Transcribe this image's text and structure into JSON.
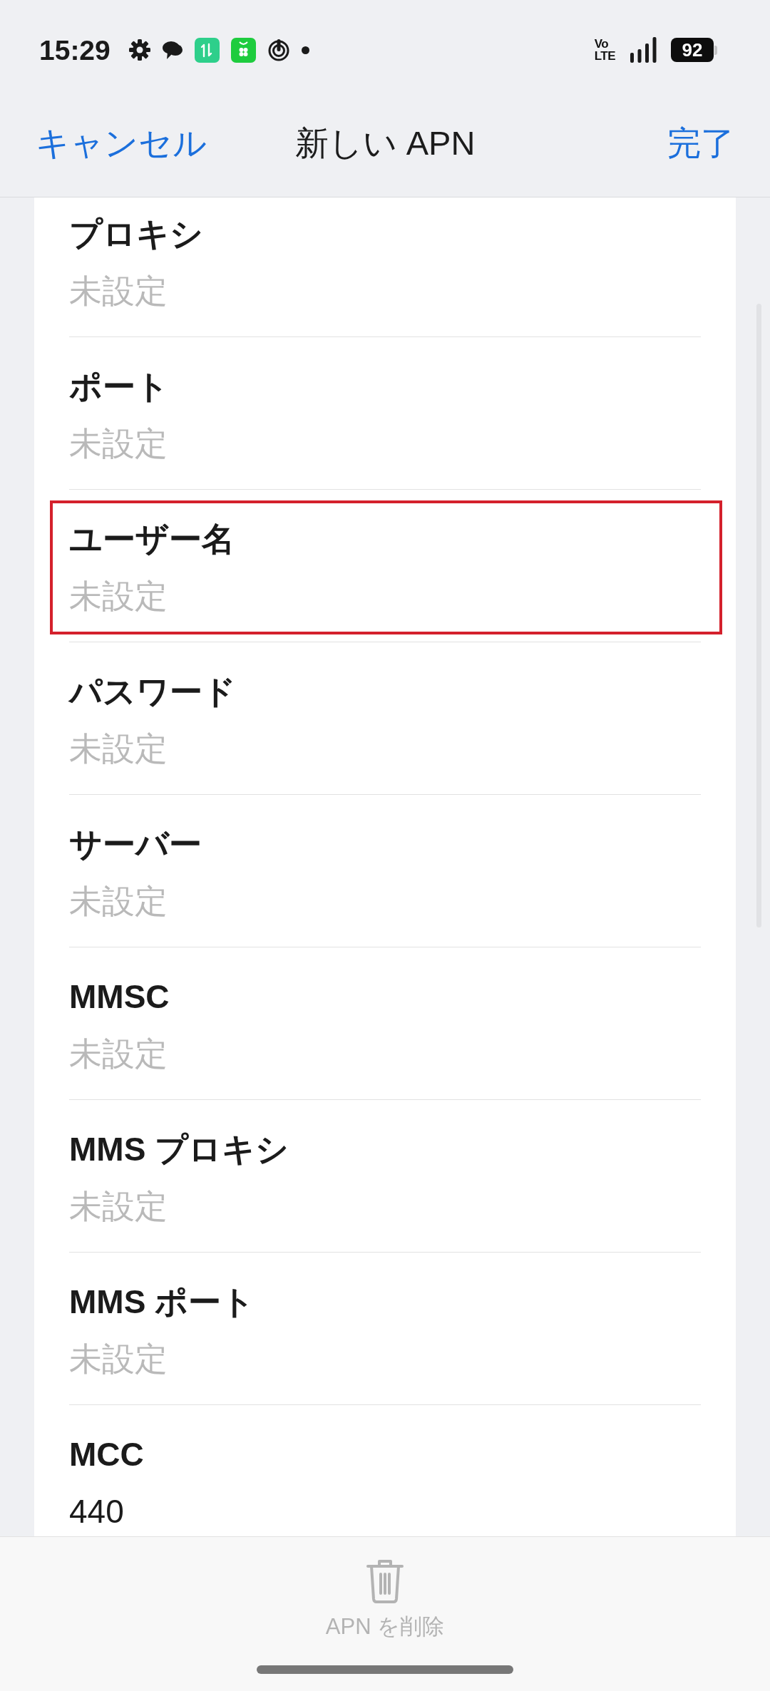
{
  "status_bar": {
    "time": "15:29",
    "network": [
      "Vo",
      "LTE"
    ],
    "battery": "92"
  },
  "header": {
    "cancel": "キャンセル",
    "title": "新しい APN",
    "done": "完了"
  },
  "fields": [
    {
      "label": "プロキシ",
      "placeholder": "未設定",
      "highlighted": false
    },
    {
      "label": "ポート",
      "placeholder": "未設定",
      "highlighted": false
    },
    {
      "label": "ユーザー名",
      "placeholder": "未設定",
      "highlighted": true
    },
    {
      "label": "パスワード",
      "placeholder": "未設定",
      "highlighted": false
    },
    {
      "label": "サーバー",
      "placeholder": "未設定",
      "highlighted": false
    },
    {
      "label": "MMSC",
      "placeholder": "未設定",
      "highlighted": false
    },
    {
      "label": "MMS プロキシ",
      "placeholder": "未設定",
      "highlighted": false
    },
    {
      "label": "MMS ポート",
      "placeholder": "未設定",
      "highlighted": false
    },
    {
      "label": "MCC",
      "value": "440",
      "highlighted": false
    }
  ],
  "delete_button": {
    "label": "APN を削除",
    "disabled": true
  }
}
